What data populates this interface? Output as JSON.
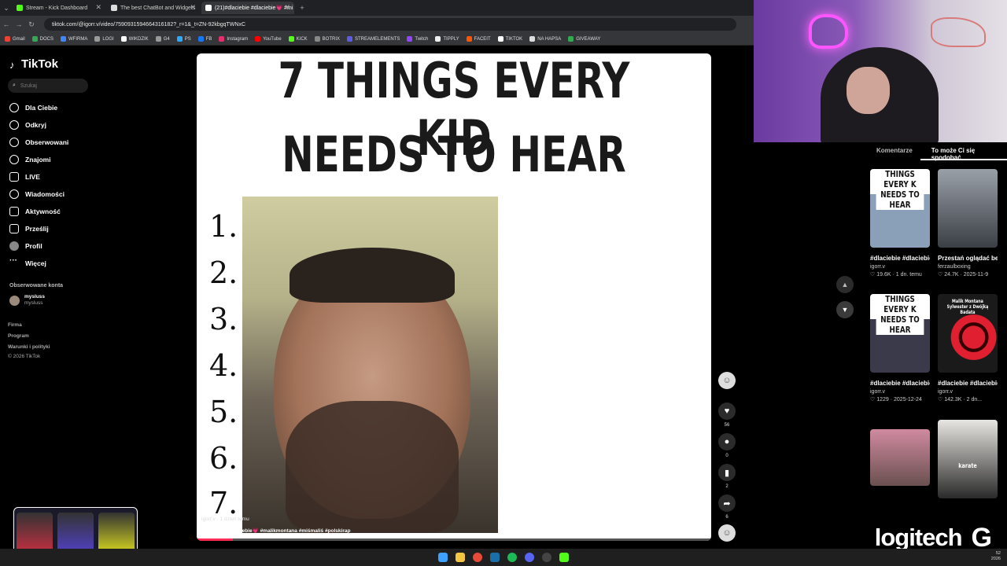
{
  "browser": {
    "tabs": [
      {
        "title": "Stream - Kick Dashboard",
        "color": "#53fc18"
      },
      {
        "title": "The best ChatBot and Widgets",
        "color": "#ffffff"
      },
      {
        "title": "(21)#dlaciebie #dlaciebie💗 #mi",
        "color": "#ffffff"
      }
    ],
    "url": "tiktok.com/@igorr.v/video/7590931594664316182?_r=1&_t=ZN-92kbgqTWNxC",
    "bookmarks": [
      "Gmail",
      "DOCS",
      "WFIRMA",
      "LOGI",
      "WIKDZIK",
      "G4",
      "PS",
      "FB",
      "Instagram",
      "YouTube",
      "KICK",
      "BOTRIX",
      "STREAMELEMENTS",
      "Twitch",
      "TIPPLY",
      "FACEIT",
      "TIKTOK",
      "NA HAPSA",
      "GIVEAWAY"
    ]
  },
  "sidebar": {
    "logo": "TikTok",
    "search_placeholder": "Szukaj",
    "items": [
      "Dla Ciebie",
      "Odkryj",
      "Obserwowani",
      "Znajomi",
      "LIVE",
      "Wiadomości",
      "Aktywność",
      "Prześlij",
      "Profil",
      "Więcej"
    ],
    "followed_title": "Obserwowane konta",
    "followed_user": "mysluss",
    "followed_handle": "mysluss",
    "footer": [
      "Firma",
      "Program",
      "Warunki i polityki",
      "© 2026 TikTok"
    ]
  },
  "video": {
    "title_line1": "7 THINGS EVERY KID",
    "title_line2": "NEEDS TO HEAR",
    "numbers": [
      "1.",
      "2.",
      "3.",
      "4.",
      "5.",
      "6.",
      "7."
    ],
    "user": "igorr.v · 1 dzień temu",
    "caption": "#dlaciebie #dlaciebie💗 #malikmontana #miśmaliś #polskirap",
    "progress": 0.07
  },
  "actions": {
    "likes": "56",
    "comments": "0",
    "saves": "2",
    "shares": "6"
  },
  "right_panel": {
    "tab_comments": "Komentarze",
    "tab_related": "To może Ci się spodobać",
    "cards": [
      {
        "thumb_text": "THINGS EVERY K NEEDS TO HEAR",
        "title": "#dlaciebie #dlaciebie💗...",
        "author": "igorr.v",
        "stats": "♡ 19.6K · 1 dn. temu"
      },
      {
        "thumb_text": "",
        "title": "Przestań oglądać bez obserwacji...",
        "author": "ferzaulboxing",
        "stats": "♡ 24.7K · 2025-11-9"
      },
      {
        "thumb_text": "THINGS EVERY K NEEDS TO HEAR",
        "title": "#dlaciebie #dlaciebie💗...",
        "author": "igorr.v",
        "stats": "♡ 1229 · 2025-12-24"
      },
      {
        "thumb_text": "Malik Montana Sylwester z Dwójką Badata",
        "title": "#dlaciebie #dlaciebie💗...",
        "author": "igorr.v",
        "stats": "♡ 142.3K · 2 dn..."
      },
      {
        "thumb_text": "",
        "title": "",
        "author": "",
        "stats": ""
      },
      {
        "thumb_text": "karate",
        "title": "",
        "author": "",
        "stats": ""
      }
    ]
  },
  "brand": {
    "logitech": "logitech"
  },
  "clock": {
    "time": "52",
    "date": "2026"
  },
  "colors": {
    "tiktok_red": "#fe2c55",
    "kick_green": "#53fc18"
  }
}
